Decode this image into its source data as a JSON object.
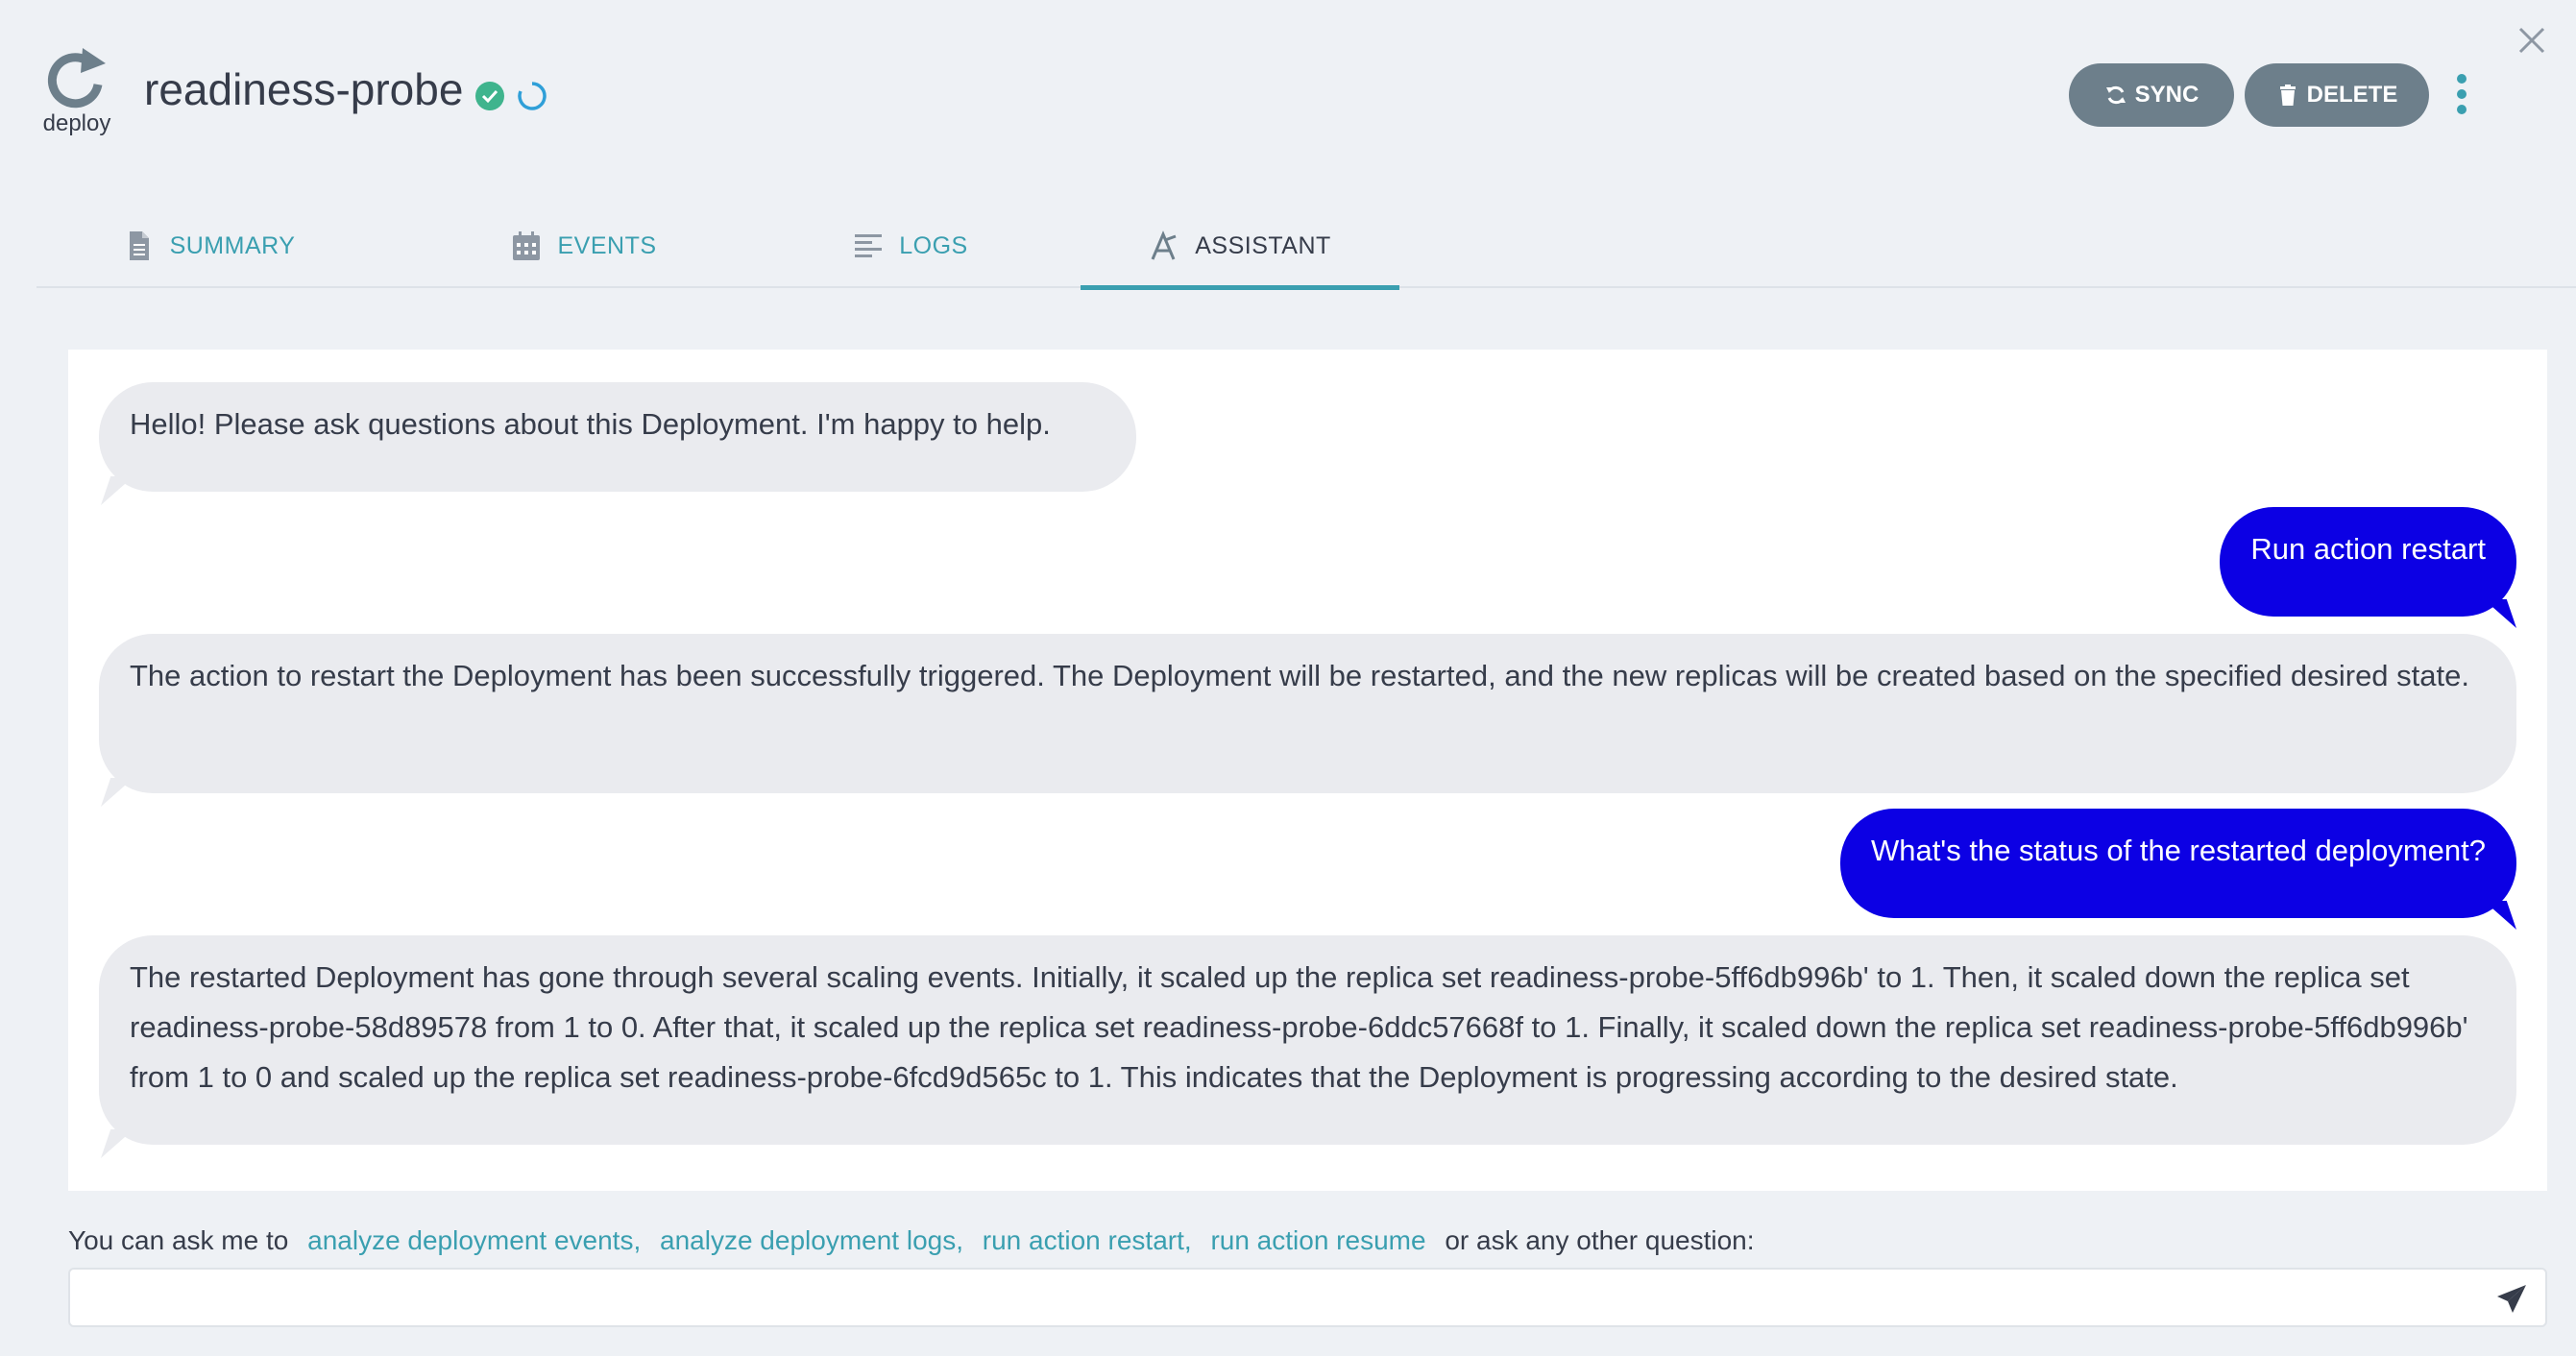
{
  "header": {
    "kind_label": "deploy",
    "title": "readiness-probe",
    "health_icon": "check-circle-icon",
    "sync_icon": "sync-progress-icon",
    "buttons": {
      "sync": "SYNC",
      "delete": "DELETE"
    }
  },
  "tabs": [
    {
      "label": "SUMMARY",
      "icon": "file-icon"
    },
    {
      "label": "EVENTS",
      "icon": "calendar-icon"
    },
    {
      "label": "LOGS",
      "icon": "align-left-icon"
    },
    {
      "label": "ASSISTANT",
      "icon": "assistant-icon",
      "active": true
    }
  ],
  "chat": {
    "messages": [
      {
        "from": "bot",
        "text": "Hello! Please ask questions about this Deployment. I'm happy to help."
      },
      {
        "from": "user",
        "text": "Run action restart"
      },
      {
        "from": "bot",
        "text": "The action to restart the Deployment has been successfully triggered. The Deployment will be restarted, and the new replicas will be created based on the specified desired state."
      },
      {
        "from": "user",
        "text": "What's the status of the restarted deployment?"
      },
      {
        "from": "bot",
        "text": "The restarted Deployment has gone through several scaling events. Initially, it scaled up the replica set readiness-probe-5ff6db996b' to 1. Then, it scaled down the replica set readiness-probe-58d89578 from 1 to 0. After that, it scaled up the replica set readiness-probe-6ddc57668f to 1. Finally, it scaled down the replica set readiness-probe-5ff6db996b' from 1 to 0 and scaled up the replica set readiness-probe-6fcd9d565c to 1. This indicates that the Deployment is progressing according to the desired state."
      }
    ]
  },
  "suggestions": {
    "prefix": "You can ask me to",
    "links": [
      "analyze deployment events,",
      "analyze deployment logs,",
      "run action restart,",
      "run action resume"
    ],
    "suffix": "or ask any other question:"
  },
  "input": {
    "value": "",
    "placeholder": ""
  },
  "colors": {
    "accent": "#3a9fb0",
    "user_bubble": "#0c00e4",
    "bot_bubble": "#eaebef",
    "button": "#6d7f8b",
    "health": "#3fb48d"
  }
}
